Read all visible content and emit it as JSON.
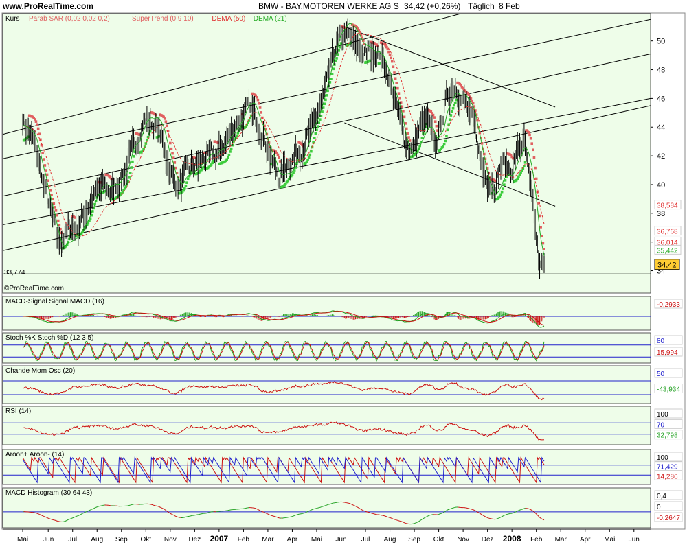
{
  "header": {
    "site": "www.ProRealTime.com",
    "title": "BMW - BAY.MOTOREN WERKE AG S",
    "last": "34,42 (+0,26%)",
    "period": "Täglich",
    "date": "8 Feb"
  },
  "colors": {
    "background": "#ffffff",
    "panel_fill": "#eefde9",
    "price_bar": "#000000",
    "sar_red": "#e06060",
    "supertrend_green": "#3dcc3d",
    "dema50": "#e03030",
    "dema21": "#22aa22",
    "macd_red": "#cc1010",
    "macd_green": "#20a020",
    "blue_line": "#2020cc",
    "channel": "#000000",
    "badge_orange": "#ffcc33"
  },
  "price_panel": {
    "title": "Kurs",
    "legends": [
      {
        "text": "Parab SAR (0,02 0,02 0,2)",
        "color": "#e06060"
      },
      {
        "text": "SuperTrend (0,9 10)",
        "color": "#e06060"
      },
      {
        "text": "DEMA (50)",
        "color": "#e03030"
      },
      {
        "text": "DEMA (21)",
        "color": "#22aa22"
      }
    ],
    "low_label": "33,774",
    "watermark": "©ProRealTime.com",
    "value_labels": [
      {
        "text": "38,584",
        "color": "#e03030",
        "y": 38.584
      },
      {
        "text": "36,768",
        "color": "#e03030",
        "y": 36.768
      },
      {
        "text": "36,014",
        "color": "#e03030",
        "y": 36.014
      },
      {
        "text": "35,442",
        "color": "#22aa22",
        "y": 35.442
      }
    ],
    "last_badge": "34,42"
  },
  "indicator_panels": [
    {
      "title": "MACD-Signal Signal MACD (16)",
      "labels": [
        {
          "text": "-0,2933",
          "color": "#cc1010"
        }
      ]
    },
    {
      "title": "Stoch %K Stoch %D (12 3 5)",
      "labels": [
        {
          "text": "80",
          "color": "#2020cc"
        },
        {
          "text": "15,994",
          "color": "#cc1010"
        }
      ]
    },
    {
      "title": "Chande Mom Osc (20)",
      "labels": [
        {
          "text": "50",
          "color": "#2020cc"
        },
        {
          "text": "-43,934",
          "color": "#20a020"
        }
      ]
    },
    {
      "title": "RSI (14)",
      "labels": [
        {
          "text": "100",
          "color": "#000000"
        },
        {
          "text": "70",
          "color": "#2020cc"
        },
        {
          "text": "32,798",
          "color": "#20a020"
        }
      ]
    },
    {
      "title": "Aroon+ Aroon- (14)",
      "labels": [
        {
          "text": "100",
          "color": "#000000"
        },
        {
          "text": "71,429",
          "color": "#2020cc"
        },
        {
          "text": "14,286",
          "color": "#cc1010"
        }
      ]
    },
    {
      "title": "MACD Histogram (30 64 43)",
      "labels": [
        {
          "text": "0,4",
          "color": "#000000"
        },
        {
          "text": "0",
          "color": "#000000"
        },
        {
          "text": "-0,2647",
          "color": "#cc1010"
        }
      ]
    }
  ],
  "chart_data": [
    {
      "type": "line",
      "title": "BMW - BAY.MOTOREN WERKE AG S",
      "ylim": [
        33.5,
        51.8
      ],
      "yticks": [
        34,
        36,
        38,
        40,
        42,
        44,
        46,
        48,
        50
      ],
      "ytick_labels": [
        "34",
        "36",
        "38",
        "40",
        "42",
        "44",
        "46",
        "48",
        "50"
      ],
      "x_labels": [
        "Mai",
        "Jun",
        "Jul",
        "Aug",
        "Sep",
        "Okt",
        "Nov",
        "Dez",
        "2007",
        "Feb",
        "Mär",
        "Apr",
        "Mai",
        "Jun",
        "Jul",
        "Aug",
        "Sep",
        "Okt",
        "Nov",
        "Dez",
        "2008",
        "Feb",
        "Mär",
        "Apr",
        "Mai",
        "Jun"
      ],
      "x_label_positions": [
        0,
        23,
        45,
        67,
        89,
        111,
        133,
        155,
        177,
        199,
        221,
        243,
        265,
        287,
        309,
        331,
        353,
        375,
        397,
        419,
        441,
        463,
        485,
        507,
        529,
        551
      ],
      "x_bold_labels": [
        "2007",
        "2008"
      ],
      "xlim": [
        -18,
        566
      ],
      "last_index": 470,
      "price_keyframes": [
        [
          0,
          44.5
        ],
        [
          10,
          43.0
        ],
        [
          22,
          39.0
        ],
        [
          32,
          36.0
        ],
        [
          42,
          37.0
        ],
        [
          50,
          37.2
        ],
        [
          62,
          39.0
        ],
        [
          72,
          39.8
        ],
        [
          80,
          39.5
        ],
        [
          92,
          41.0
        ],
        [
          100,
          42.5
        ],
        [
          110,
          44.5
        ],
        [
          122,
          44.0
        ],
        [
          135,
          40.5
        ],
        [
          142,
          40.0
        ],
        [
          150,
          41.0
        ],
        [
          165,
          41.8
        ],
        [
          175,
          42.0
        ],
        [
          195,
          44.5
        ],
        [
          205,
          45.3
        ],
        [
          215,
          44.0
        ],
        [
          225,
          41.5
        ],
        [
          232,
          40.5
        ],
        [
          238,
          41.5
        ],
        [
          250,
          42.5
        ],
        [
          262,
          44.0
        ],
        [
          275,
          47.0
        ],
        [
          282,
          49.5
        ],
        [
          292,
          50.5
        ],
        [
          300,
          49.5
        ],
        [
          310,
          49.0
        ],
        [
          320,
          49.5
        ],
        [
          328,
          48.0
        ],
        [
          338,
          45.0
        ],
        [
          345,
          43.0
        ],
        [
          352,
          42.5
        ],
        [
          358,
          44.0
        ],
        [
          365,
          44.5
        ],
        [
          372,
          42.5
        ],
        [
          382,
          46.0
        ],
        [
          390,
          47.0
        ],
        [
          400,
          45.5
        ],
        [
          408,
          43.5
        ],
        [
          415,
          41.0
        ],
        [
          425,
          40.0
        ],
        [
          432,
          41.5
        ],
        [
          440,
          41.0
        ],
        [
          447,
          42.5
        ],
        [
          452,
          43.0
        ],
        [
          457,
          40.0
        ],
        [
          462,
          37.0
        ],
        [
          466,
          34.0
        ],
        [
          470,
          34.42
        ]
      ],
      "channels": [
        {
          "name": "up-channel-1",
          "points": [
            [
              -18,
              43.5
            ],
            [
              400,
              52.0
            ]
          ]
        },
        {
          "name": "up-channel-2",
          "points": [
            [
              -18,
              41.8
            ],
            [
              566,
              51.5
            ]
          ]
        },
        {
          "name": "up-channel-3",
          "points": [
            [
              -18,
              39.2
            ],
            [
              566,
              49.1
            ]
          ]
        },
        {
          "name": "up-channel-4",
          "points": [
            [
              -18,
              37.2
            ],
            [
              566,
              46.0
            ]
          ]
        },
        {
          "name": "up-channel-5",
          "points": [
            [
              -18,
              35.4
            ],
            [
              566,
              45.5
            ]
          ]
        },
        {
          "name": "down-channel-1",
          "points": [
            [
              290,
              51.0
            ],
            [
              480,
              45.4
            ]
          ]
        },
        {
          "name": "down-channel-2",
          "points": [
            [
              290,
              44.3
            ],
            [
              480,
              38.5
            ]
          ]
        }
      ]
    },
    {
      "type": "line",
      "title": "MACD-Signal Signal MACD (16)",
      "ylim": [
        -0.9,
        0.9
      ],
      "reference_lines": [
        0
      ],
      "last_values": [
        -0.2933
      ]
    },
    {
      "type": "line",
      "title": "Stoch %K Stoch %D (12 3 5)",
      "ylim": [
        0,
        100
      ],
      "reference_lines": [
        20,
        80
      ],
      "last_values": [
        15.994
      ]
    },
    {
      "type": "line",
      "title": "Chande Mom Osc (20)",
      "ylim": [
        -100,
        100
      ],
      "reference_lines": [
        -50,
        50
      ],
      "last_values": [
        -43.934
      ]
    },
    {
      "type": "line",
      "title": "RSI (14)",
      "ylim": [
        0,
        100
      ],
      "reference_lines": [
        30,
        70
      ],
      "last_values": [
        32.798
      ]
    },
    {
      "type": "line",
      "title": "Aroon+ Aroon- (14)",
      "ylim": [
        0,
        100
      ],
      "reference_lines": [
        30,
        70
      ],
      "last_values": [
        71.429,
        14.286
      ]
    },
    {
      "type": "line",
      "title": "MACD Histogram (30 64 43)",
      "ylim": [
        -0.75,
        0.85
      ],
      "reference_lines": [
        0
      ],
      "last_values": [
        -0.2647
      ]
    }
  ]
}
